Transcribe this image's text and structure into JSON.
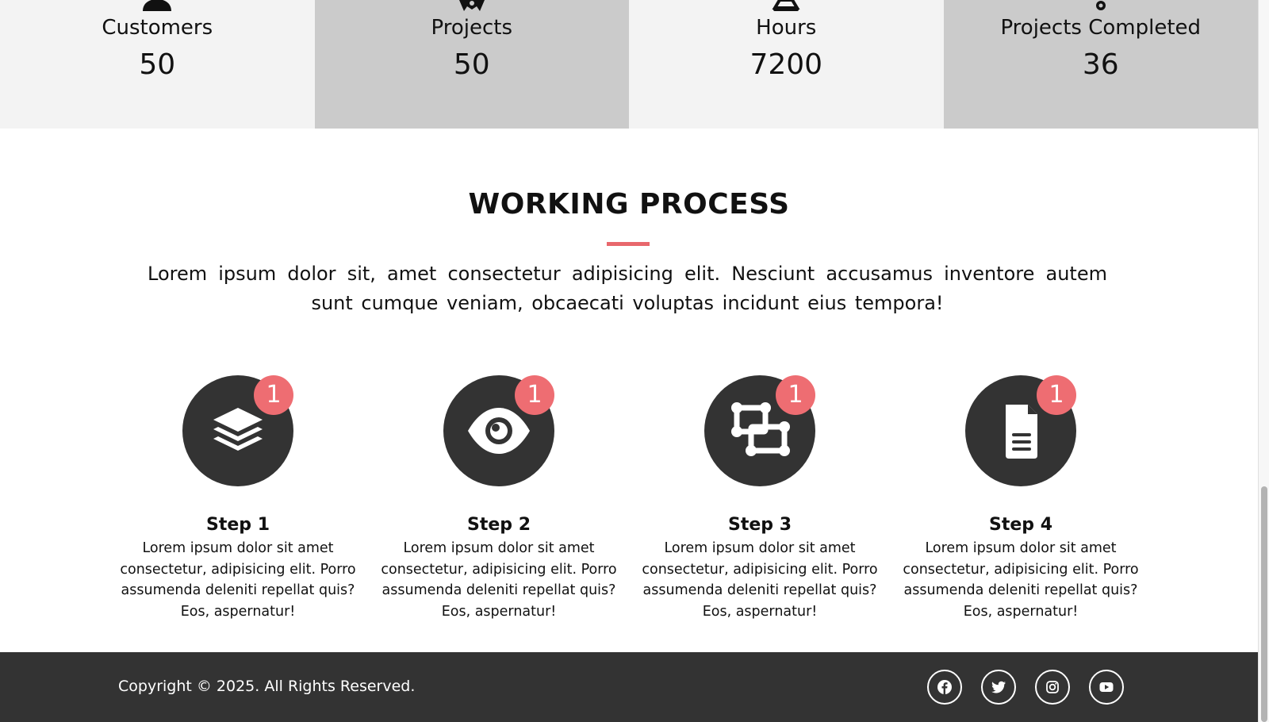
{
  "stats": [
    {
      "label": "Customers",
      "value": "50",
      "icon": "user-icon"
    },
    {
      "label": "Projects",
      "value": "50",
      "icon": "award-icon"
    },
    {
      "label": "Hours",
      "value": "7200",
      "icon": "hourglass-icon"
    },
    {
      "label": "Projects Completed",
      "value": "36",
      "icon": "marker-icon"
    }
  ],
  "process": {
    "title": "WORKING PROCESS",
    "intro": "Lorem ipsum dolor sit, amet consectetur adipisicing elit. Nesciunt accusamus inventore autem sunt cumque veniam, obcaecati voluptas incidunt eius tempora!",
    "steps": [
      {
        "title": "Step 1",
        "badge": "1",
        "icon": "layers-icon",
        "text": "Lorem ipsum dolor sit amet consectetur, adipisicing elit. Porro assumenda deleniti repellat quis? Eos, aspernatur!"
      },
      {
        "title": "Step 2",
        "badge": "1",
        "icon": "eye-icon",
        "text": "Lorem ipsum dolor sit amet consectetur, adipisicing elit. Porro assumenda deleniti repellat quis? Eos, aspernatur!"
      },
      {
        "title": "Step 3",
        "badge": "1",
        "icon": "object-group-icon",
        "text": "Lorem ipsum dolor sit amet consectetur, adipisicing elit. Porro assumenda deleniti repellat quis? Eos, aspernatur!"
      },
      {
        "title": "Step 4",
        "badge": "1",
        "icon": "file-lines-icon",
        "text": "Lorem ipsum dolor sit amet consectetur, adipisicing elit. Porro assumenda deleniti repellat quis? Eos, aspernatur!"
      }
    ]
  },
  "footer": {
    "copyright": "Copyright © 2025. All Rights Reserved.",
    "social": [
      "facebook-icon",
      "twitter-icon",
      "instagram-icon",
      "youtube-icon"
    ]
  },
  "colors": {
    "accent": "#ee6d72",
    "dark": "#333333",
    "stat_light": "#f3f3f3",
    "stat_dark": "#cbcbcb"
  }
}
